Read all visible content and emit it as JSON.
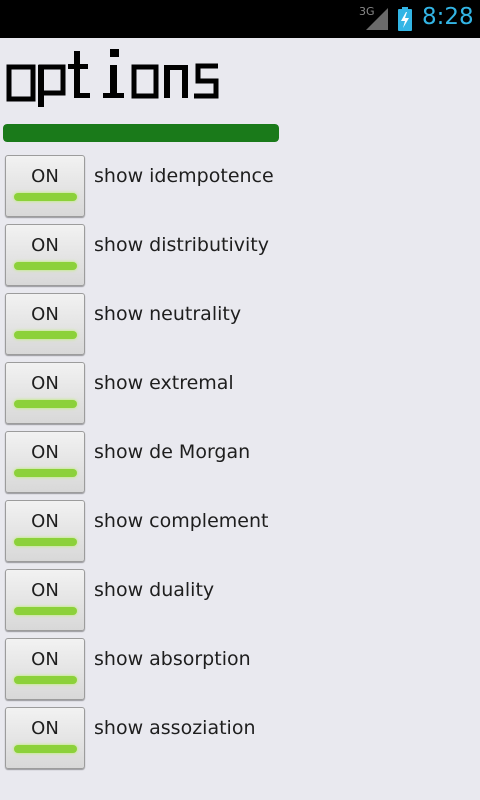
{
  "status_bar": {
    "network": "3G",
    "time": "8:28",
    "icons": [
      "signal-icon",
      "battery-charging-icon"
    ],
    "time_color": "#33b5e5"
  },
  "title": "options",
  "progress": {
    "fraction": 1.0,
    "color": "#1a7a1a"
  },
  "options": [
    {
      "toggle_label": "ON",
      "label": "show idempotence"
    },
    {
      "toggle_label": "ON",
      "label": "show distributivity"
    },
    {
      "toggle_label": "ON",
      "label": "show neutrality"
    },
    {
      "toggle_label": "ON",
      "label": "show extremal"
    },
    {
      "toggle_label": "ON",
      "label": "show de Morgan"
    },
    {
      "toggle_label": "ON",
      "label": "show complement"
    },
    {
      "toggle_label": "ON",
      "label": "show duality"
    },
    {
      "toggle_label": "ON",
      "label": "show absorption"
    },
    {
      "toggle_label": "ON",
      "label": "show assoziation"
    }
  ],
  "colors": {
    "toggle_on": "#8cd13a",
    "background": "#e9e9ef"
  }
}
